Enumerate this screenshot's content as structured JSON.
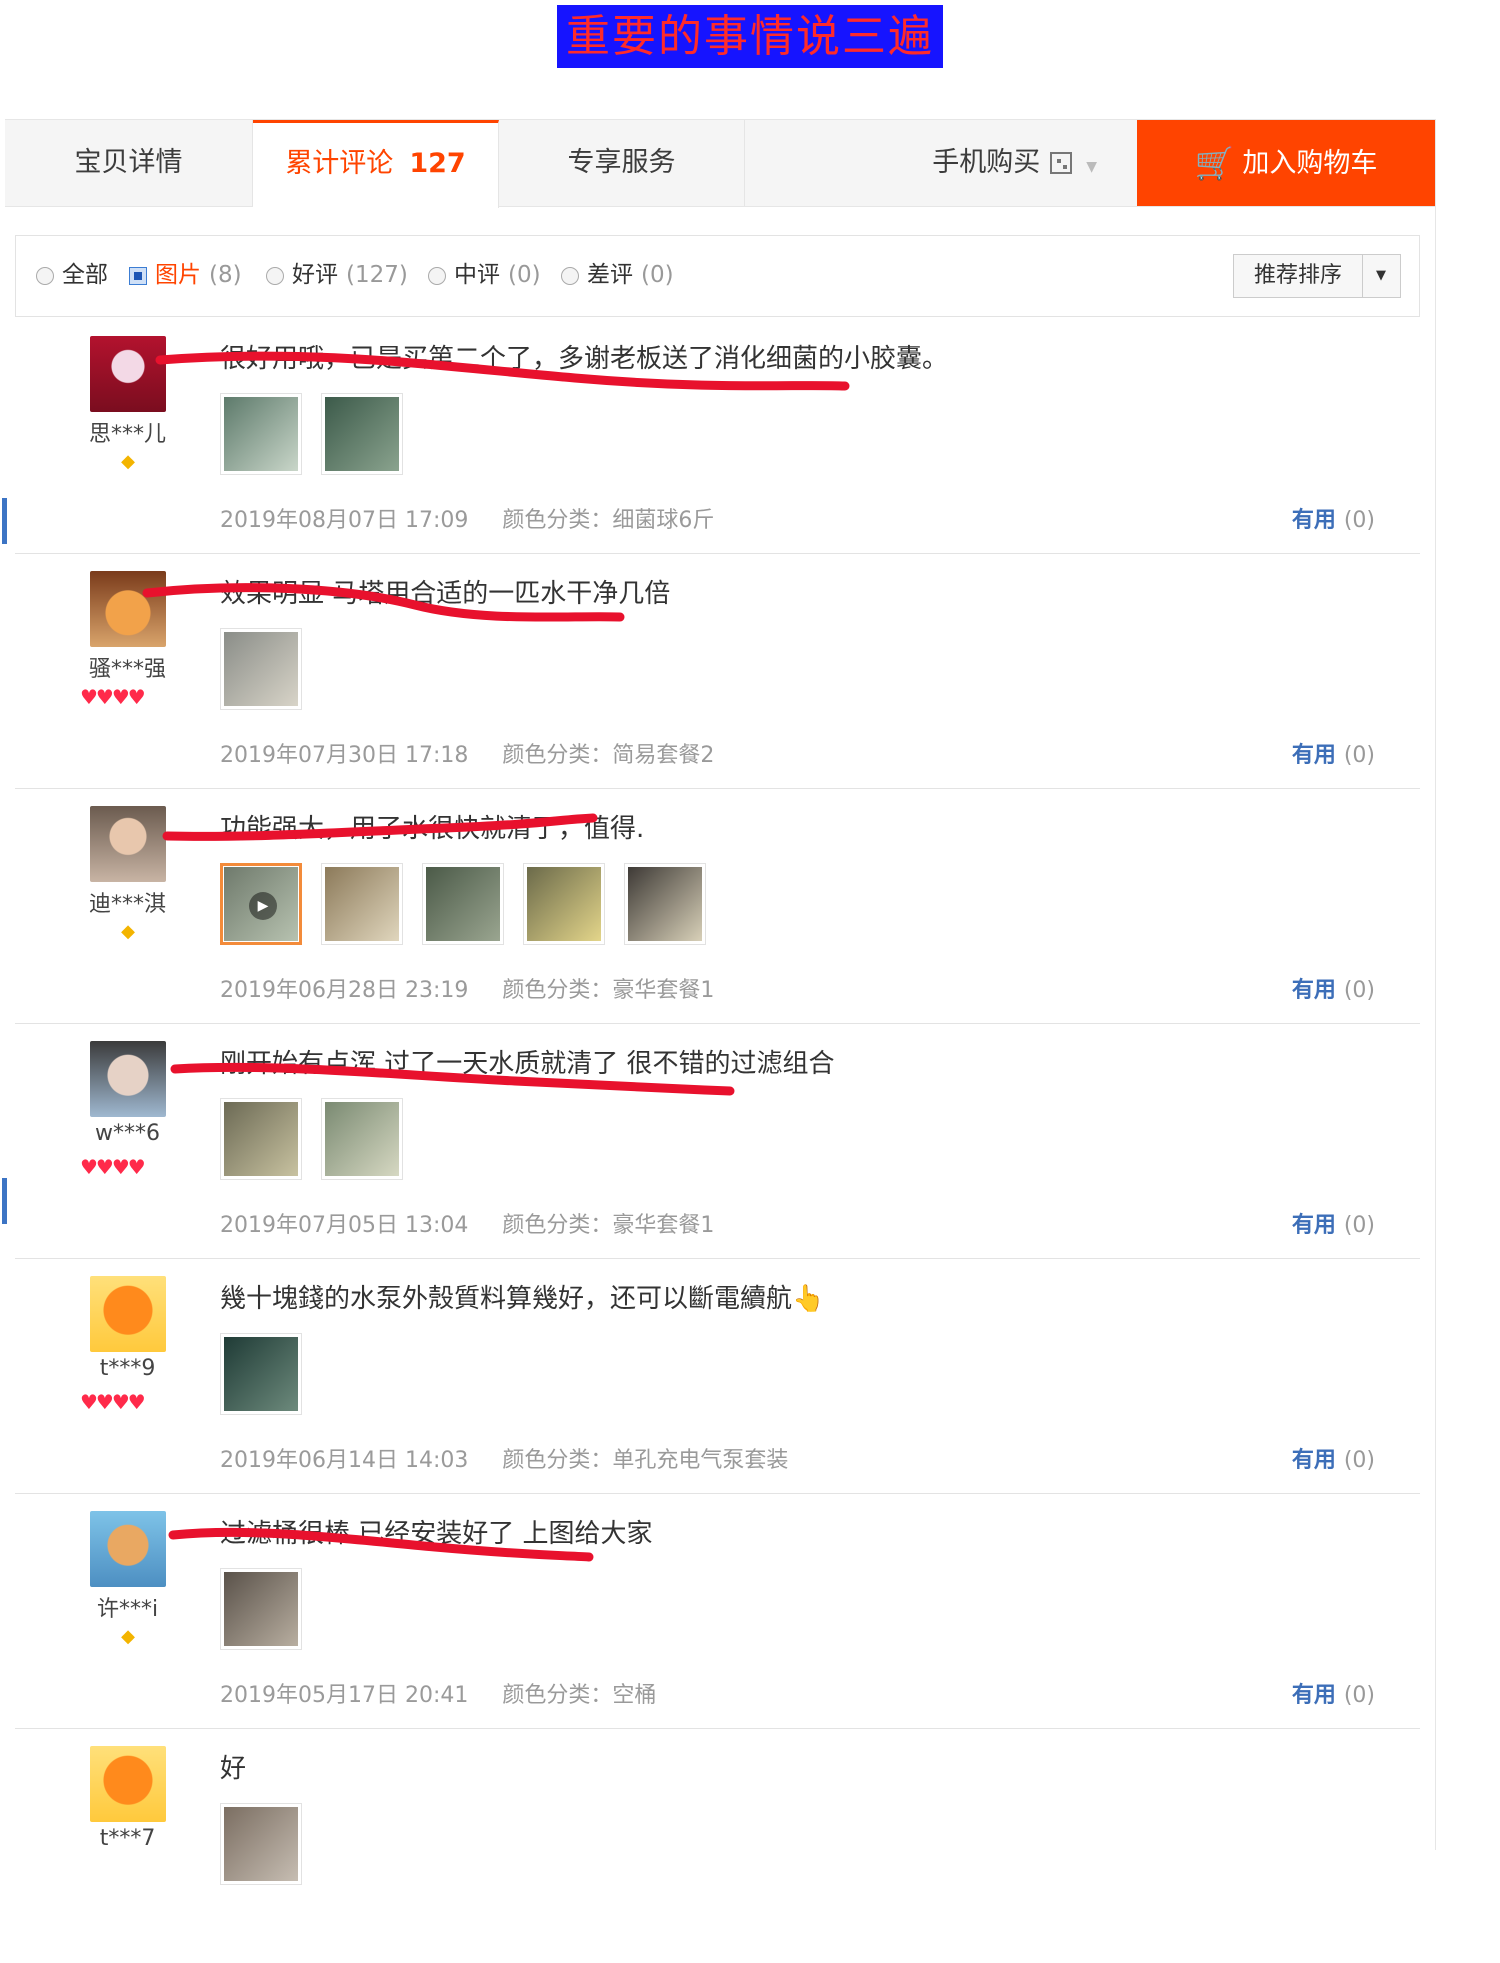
{
  "banner": {
    "text": "重要的事情说三遍"
  },
  "tabs": [
    {
      "label": "宝贝详情"
    },
    {
      "label": "累计评论",
      "count": "127"
    },
    {
      "label": "专享服务"
    },
    {
      "label": "手机购买",
      "icon": "qr-code-icon"
    }
  ],
  "cart_button": {
    "label": "加入购物车",
    "icon": "cart-icon"
  },
  "filters": [
    {
      "label": "全部",
      "count": ""
    },
    {
      "label": "图片",
      "count": "(8)"
    },
    {
      "label": "好评",
      "count": "(127)"
    },
    {
      "label": "中评",
      "count": "(0)"
    },
    {
      "label": "差评",
      "count": "(0)"
    }
  ],
  "sort": {
    "label": "推荐排序"
  },
  "colors": {
    "accent": "#ff4400",
    "banner_bg": "#1614ff",
    "banner_text": "#ff2a2a",
    "link": "#3c6eb8",
    "underline": "#e8112d"
  },
  "reviews": [
    {
      "user": "思***儿",
      "badge": "diamond",
      "text": "很好用哦，已是买第二个了，多谢老板送了消化细菌的小胶囊。",
      "date": "2019年08月07日 17:09",
      "sku": "颜色分类：细菌球6斤",
      "helpful": "有用",
      "helpful_count": "(0)",
      "images": 2
    },
    {
      "user": "骚***强",
      "badge": "hearts",
      "text": "效果明显 马塔用合适的一匹水干净几倍",
      "date": "2019年07月30日 17:18",
      "sku": "颜色分类：简易套餐2",
      "helpful": "有用",
      "helpful_count": "(0)",
      "images": 1
    },
    {
      "user": "迪***淇",
      "badge": "diamond",
      "text": "功能强大，用了水很快就清了，值得.",
      "date": "2019年06月28日 23:19",
      "sku": "颜色分类：豪华套餐1",
      "helpful": "有用",
      "helpful_count": "(0)",
      "images": 5
    },
    {
      "user": "w***6",
      "badge": "hearts",
      "text": "刚开始有点浑 过了一天水质就清了 很不错的过滤组合",
      "date": "2019年07月05日 13:04",
      "sku": "颜色分类：豪华套餐1",
      "helpful": "有用",
      "helpful_count": "(0)",
      "images": 2
    },
    {
      "user": "t***9",
      "badge": "hearts",
      "text": "幾十塊錢的水泵外殼質料算幾好，还可以斷電續航👆",
      "date": "2019年06月14日 14:03",
      "sku": "颜色分类：单孔充电气泵套装",
      "helpful": "有用",
      "helpful_count": "(0)",
      "images": 1
    },
    {
      "user": "许***i",
      "badge": "diamond",
      "text": "过滤桶很棒 已经安装好了 上图给大家",
      "date": "2019年05月17日 20:41",
      "sku": "颜色分类：空桶",
      "helpful": "有用",
      "helpful_count": "(0)",
      "images": 1
    },
    {
      "user": "t***7",
      "badge": "",
      "text": "好",
      "date": "",
      "sku": "",
      "helpful": "",
      "helpful_count": "",
      "images": 1
    }
  ]
}
